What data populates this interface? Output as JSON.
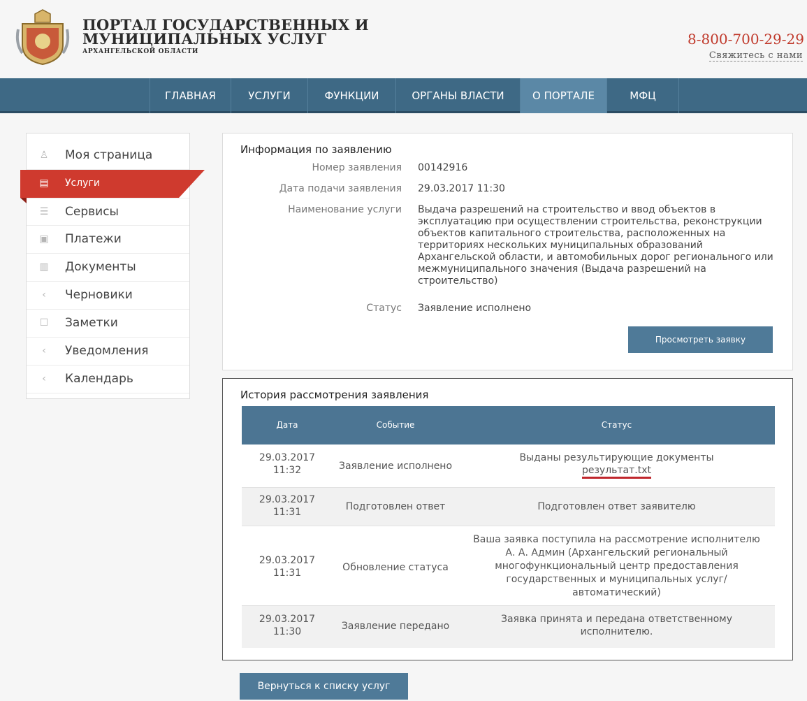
{
  "header": {
    "brand_line1": "ПОРТАЛ ГОСУДАРСТВЕННЫХ И",
    "brand_line2": "МУНИЦИПАЛЬНЫХ УСЛУГ",
    "brand_sub": "АРХАНГЕЛЬСКОЙ ОБЛАСТИ",
    "phone": "8-800-700-29-29",
    "contact": "Свяжитесь с нами"
  },
  "nav": {
    "items": [
      "ГЛАВНАЯ",
      "УСЛУГИ",
      "ФУНКЦИИ",
      "ОРГАНЫ ВЛАСТИ",
      "О ПОРТАЛЕ",
      "МФЦ"
    ]
  },
  "sidebar": {
    "items": [
      {
        "label": "Моя страница",
        "icon": "user-icon"
      },
      {
        "label": "Услуги",
        "icon": "services-icon"
      },
      {
        "label": "Сервисы",
        "icon": "list-icon"
      },
      {
        "label": "Платежи",
        "icon": "wallet-icon"
      },
      {
        "label": "Документы",
        "icon": "document-icon"
      },
      {
        "label": "Черновики",
        "icon": "chevron-left-icon"
      },
      {
        "label": "Заметки",
        "icon": "note-icon"
      },
      {
        "label": "Уведомления",
        "icon": "chevron-left-icon"
      },
      {
        "label": "Календарь",
        "icon": "chevron-left-icon"
      }
    ]
  },
  "info": {
    "title": "Информация по заявлению",
    "number_label": "Номер заявления",
    "number_value": "00142916",
    "date_label": "Дата подачи заявления",
    "date_value": "29.03.2017 11:30",
    "service_label": "Наименование услуги",
    "service_value": "Выдача разрешений на строительство и ввод объектов в эксплуатацию при осуществлении строительства, реконструкции объектов капитального строительства, расположенных на территориях нескольких муниципальных образований Архангельской области, и автомобильных дорог регионального или межмуниципального значения (Выдача разрешений на строительство)",
    "status_label": "Статус",
    "status_value": "Заявление исполнено",
    "view_button": "Просмотреть заявку"
  },
  "history": {
    "title": "История рассмотрения заявления",
    "headers": [
      "Дата",
      "Событие",
      "Статус"
    ],
    "rows": [
      {
        "date": "29.03.2017",
        "time": "11:32",
        "event": "Заявление исполнено",
        "status": "Выданы результирующие документы",
        "link": "результат.txt"
      },
      {
        "date": "29.03.2017",
        "time": "11:31",
        "event": "Подготовлен ответ",
        "status": "Подготовлен ответ заявителю"
      },
      {
        "date": "29.03.2017",
        "time": "11:31",
        "event": "Обновление статуса",
        "status": "Ваша заявка поступила на рассмотрение исполнителю А. А. Админ (Архангельский региональный многофункциональный центр предоставления государственных и муниципальных услуг/автоматический)"
      },
      {
        "date": "29.03.2017",
        "time": "11:30",
        "event": "Заявление передано",
        "status": "Заявка принята и передана ответственному исполнителю."
      }
    ]
  },
  "back_button": "Вернуться к списку услуг",
  "colors": {
    "nav": "#3e6985",
    "accent": "#cf3a2e",
    "button": "#4f7a98",
    "phone": "#c0392b"
  }
}
